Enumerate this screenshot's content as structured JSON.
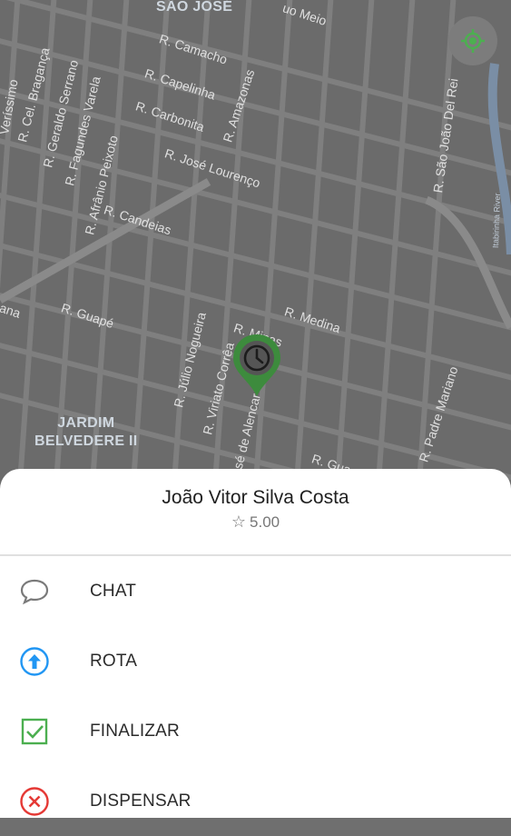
{
  "map": {
    "streets": [
      "SÃO JOSÉ",
      "R. Camacho",
      "uo Meio",
      "R. Capelinha",
      "R. Carbonita",
      "R. Amazonas",
      "R. José Lourenço",
      "R. Candeias",
      "R. Guapé",
      "R. Medina",
      "R. Minas",
      "R. Júlio Nogueira",
      "R. Viriato Corrêa",
      "José de Alencar",
      "R. Gua",
      "R. Padre Mariano",
      "R. São João Del Rei",
      "Veríssimo",
      "R. Cel. Bragança",
      "R. Geraldo Serrano",
      "R. Fagundes Varela",
      "R. Afrânio Peixoto",
      "ana",
      "Itabirinha River"
    ],
    "areas": [
      "JARDIM",
      "BELVEDERE II"
    ],
    "colors": {
      "background": "#6b6b6b",
      "road": "#7e7e7e",
      "river": "#7a8ea5",
      "pin": "#3d8b3d"
    }
  },
  "controls": {
    "locate_icon": "my-location-icon"
  },
  "passenger": {
    "name": "João Vitor Silva Costa",
    "rating": "5.00"
  },
  "actions": [
    {
      "label": "CHAT",
      "icon": "chat-bubble-icon",
      "color": "#777777"
    },
    {
      "label": "ROTA",
      "icon": "arrow-up-circle-icon",
      "color": "#2196f3"
    },
    {
      "label": "FINALIZAR",
      "icon": "check-box-icon",
      "color": "#4caf50"
    },
    {
      "label": "DISPENSAR",
      "icon": "cancel-circle-icon",
      "color": "#e53935"
    }
  ]
}
